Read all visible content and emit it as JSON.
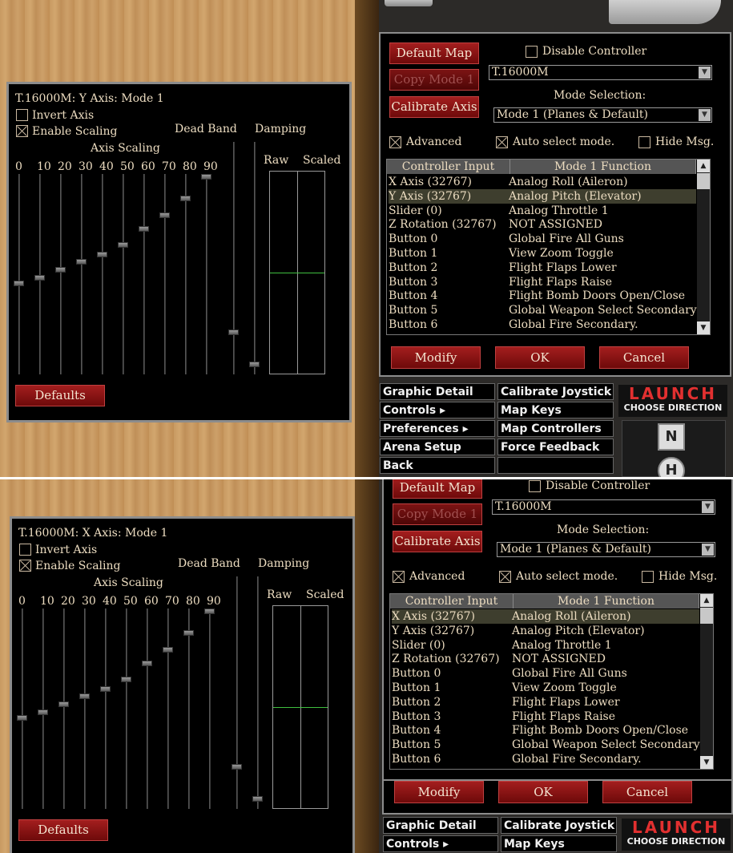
{
  "screens": [
    {
      "panel_title": "T.16000M:  Y Axis:  Mode 1",
      "selected_row": 1,
      "scaling_thumbs": [
        0.55,
        0.52,
        0.48,
        0.44,
        0.4,
        0.35,
        0.27,
        0.2,
        0.11,
        0.0
      ],
      "deadband_thumb": 0.83,
      "damping_thumb": 0.97
    },
    {
      "panel_title": "T.16000M:  X Axis:  Mode 1",
      "selected_row": 0,
      "scaling_thumbs": [
        0.55,
        0.52,
        0.48,
        0.44,
        0.4,
        0.35,
        0.27,
        0.2,
        0.11,
        0.0
      ],
      "deadband_thumb": 0.83,
      "damping_thumb": 0.97
    }
  ],
  "axis_panel": {
    "invert_axis_label": "Invert Axis",
    "invert_axis_checked": false,
    "enable_scaling_label": "Enable Scaling",
    "enable_scaling_checked": true,
    "axis_scaling_label": "Axis Scaling",
    "dead_band_label": "Dead Band",
    "damping_label": "Damping",
    "raw_label": "Raw",
    "scaled_label": "Scaled",
    "scale_ticks": [
      "0",
      "10",
      "20",
      "30",
      "40",
      "50",
      "60",
      "70",
      "80",
      "90"
    ],
    "defaults_button": "Defaults"
  },
  "controller_panel": {
    "default_map_button": "Default Map",
    "copy_mode_button": "Copy Mode 1",
    "calibrate_axis_button": "Calibrate Axis",
    "disable_controller_label": "Disable Controller",
    "disable_controller_checked": false,
    "device_select_value": "T.16000M",
    "mode_selection_label": "Mode Selection:",
    "mode_select_value": "Mode 1 (Planes & Default)",
    "advanced_label": "Advanced",
    "advanced_checked": true,
    "auto_select_label": "Auto select mode.",
    "auto_select_checked": true,
    "hide_msg_label": "Hide Msg.",
    "hide_msg_checked": false,
    "columns": [
      "Controller Input",
      "Mode 1 Function"
    ],
    "rows": [
      {
        "input": "X Axis (32767)",
        "function": "Analog Roll (Aileron)"
      },
      {
        "input": "Y Axis (32767)",
        "function": "Analog Pitch (Elevator)"
      },
      {
        "input": "Slider (0)",
        "function": "Analog Throttle 1"
      },
      {
        "input": "Z Rotation (32767)",
        "function": "  NOT ASSIGNED"
      },
      {
        "input": "Button 0",
        "function": "Global Fire All Guns"
      },
      {
        "input": "Button 1",
        "function": "View Zoom Toggle"
      },
      {
        "input": "Button 2",
        "function": "Flight Flaps Lower"
      },
      {
        "input": "Button 3",
        "function": "Flight Flaps Raise"
      },
      {
        "input": "Button 4",
        "function": "Flight Bomb Doors Open/Close"
      },
      {
        "input": "Button 5",
        "function": "Global Weapon Select Secondary"
      },
      {
        "input": "Button 6",
        "function": "Global Fire Secondary."
      }
    ],
    "modify_button": "Modify",
    "ok_button": "OK",
    "cancel_button": "Cancel"
  },
  "menu": {
    "left": [
      "Graphic Detail",
      "Controls ▸",
      "Preferences ▸",
      "Arena Setup",
      "Back"
    ],
    "right": [
      "Calibrate Joystick",
      "Map Keys",
      "Map Controllers",
      "Force Feedback",
      ""
    ]
  },
  "launch": {
    "title": "LAUNCH",
    "subtitle": "CHOOSE DIRECTION",
    "north": "N",
    "home": "H"
  },
  "colors": {
    "button_red": "#8b1414",
    "text": "#ecdcc0",
    "scaled_line": "#3fbf3f",
    "launch_red": "#e23030"
  }
}
